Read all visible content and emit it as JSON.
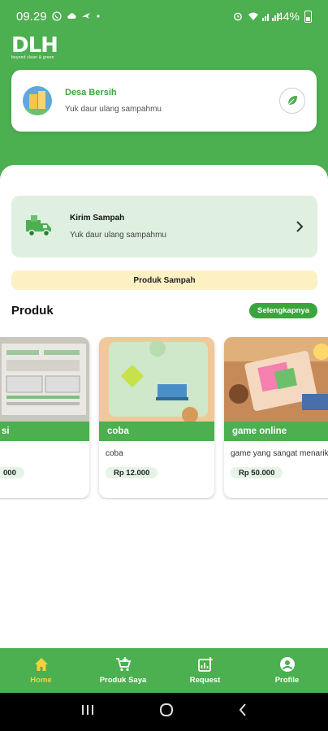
{
  "status_bar": {
    "time": "09.29",
    "battery_percent": "44%"
  },
  "app": {
    "logo_text": "DLH",
    "logo_tagline": "beyond clean & green"
  },
  "village": {
    "name": "Desa Bersih",
    "subtitle": "Yuk daur ulang sampahmu"
  },
  "send_waste": {
    "title": "Kirim Sampah",
    "subtitle": "Yuk daur ulang sampahmu"
  },
  "banner": {
    "label": "Produk Sampah"
  },
  "products_section": {
    "title": "Produk",
    "more_label": "Selengkapnya"
  },
  "products": [
    {
      "name": "si",
      "description": "",
      "price": "000"
    },
    {
      "name": "coba",
      "description": "coba",
      "price": "Rp 12.000"
    },
    {
      "name": "game online",
      "description": "game yang sangat menarik",
      "price": "Rp 50.000"
    }
  ],
  "bottom_nav": {
    "items": [
      {
        "label": "Home",
        "icon": "home-icon",
        "active": true
      },
      {
        "label": "Produk Saya",
        "icon": "cart-icon",
        "active": false
      },
      {
        "label": "Request",
        "icon": "request-icon",
        "active": false
      },
      {
        "label": "Profile",
        "icon": "profile-icon",
        "active": false
      }
    ]
  },
  "colors": {
    "primary": "#4caf50",
    "accent_active": "#f5d13b",
    "banner_bg": "#fdf1c4",
    "card_tint": "#dff0e1"
  }
}
